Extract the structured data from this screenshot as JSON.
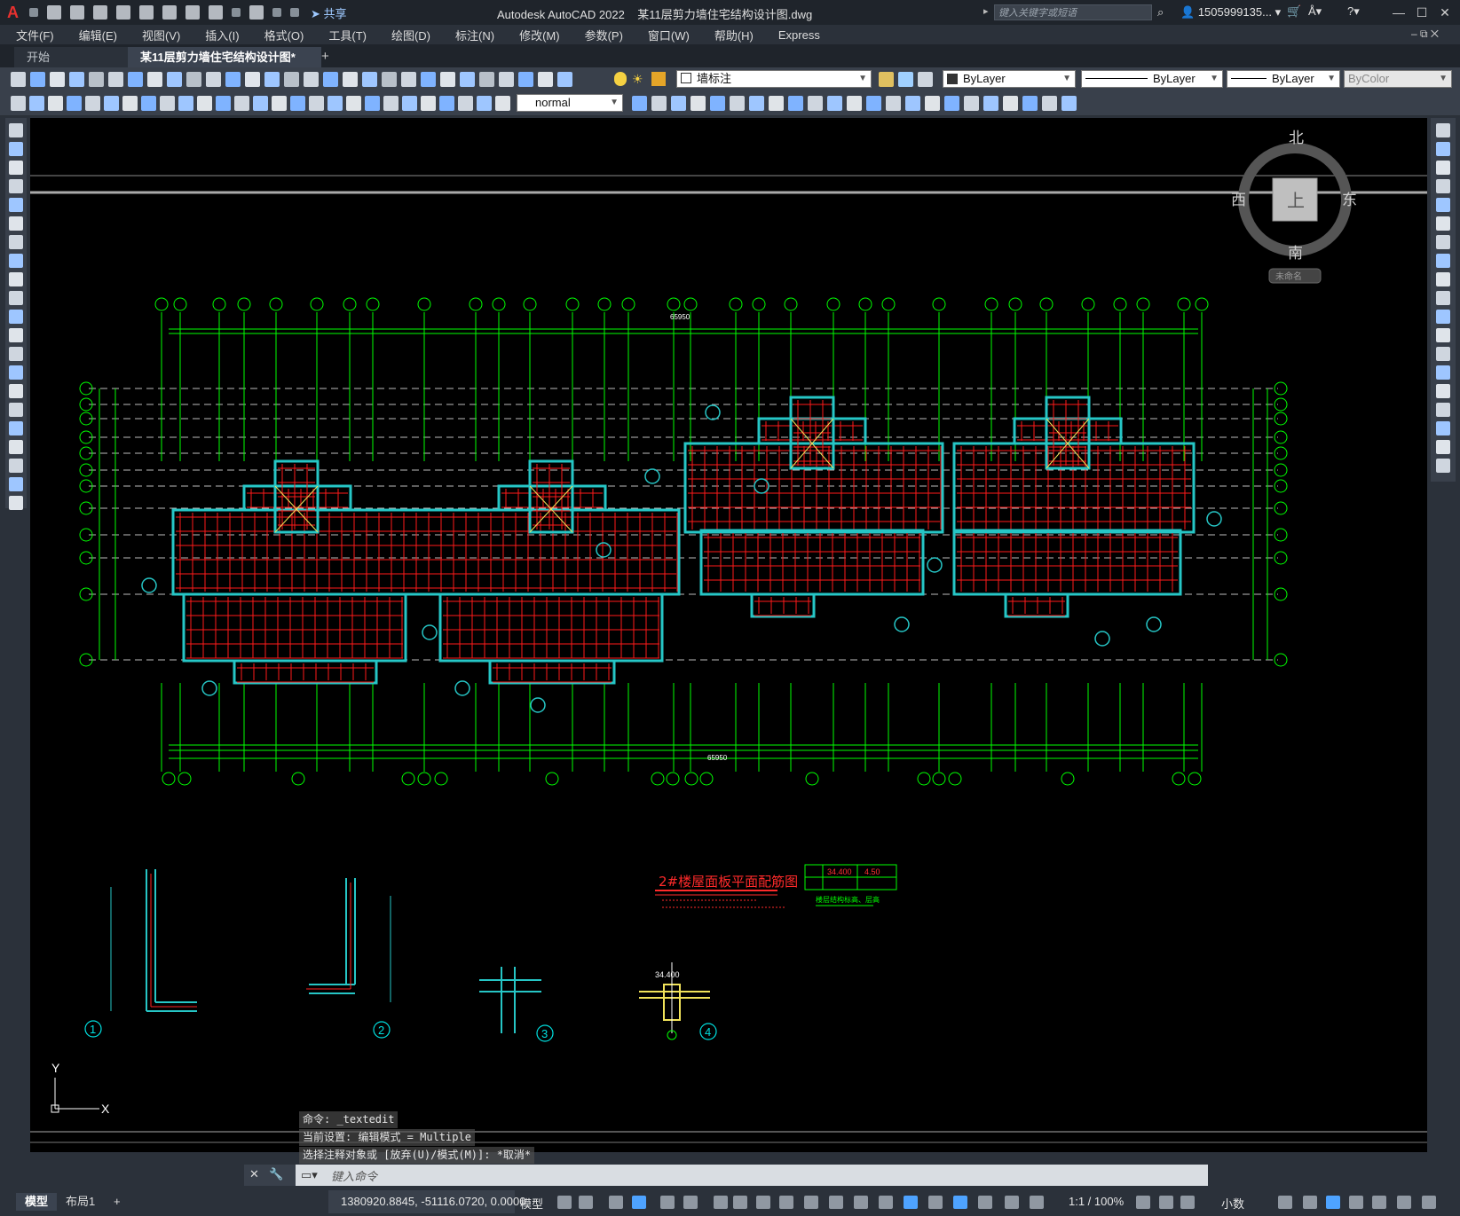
{
  "window": {
    "app_title": "Autodesk AutoCAD 2022",
    "file_title": "某11层剪力墙住宅结构设计图.dwg",
    "search_placeholder": "键入关键字或短语",
    "user": "1505999135...",
    "share_label": "共享",
    "app_logo": "A"
  },
  "menu": [
    "文件(F)",
    "编辑(E)",
    "视图(V)",
    "插入(I)",
    "格式(O)",
    "工具(T)",
    "绘图(D)",
    "标注(N)",
    "修改(M)",
    "参数(P)",
    "窗口(W)",
    "帮助(H)",
    "Express"
  ],
  "tabs": {
    "start": "开始",
    "drawing": "某11层剪力墙住宅结构设计图*",
    "new": "+"
  },
  "toolbar": {
    "layer": "墙标注",
    "color": "ByLayer",
    "linetype": "ByLayer",
    "lineweight": "ByLayer",
    "plotstyle": "ByColor",
    "textstyle": "normal"
  },
  "viewcube": {
    "north": "北",
    "south": "南",
    "east": "东",
    "west": "西",
    "top": "上",
    "wcs": "未命名"
  },
  "drawing": {
    "plan_title": "2#楼屋面板平面配筋图",
    "total_dim": "65950",
    "elev_label": "34.400",
    "table_elev": "34.400",
    "table_height": "4.50",
    "table_caption": "楼层结构标高、层高",
    "details": [
      "1",
      "2",
      "3",
      "4"
    ],
    "ucs_y": "Y",
    "ucs_x": "X"
  },
  "command": {
    "history": [
      "命令: _textedit",
      "当前设置: 编辑模式 = Multiple",
      "选择注释对象或 [放弃(U)/模式(M)]: *取消*"
    ],
    "placeholder": "键入命令"
  },
  "status": {
    "tab_model": "模型",
    "tab_layout": "布局1",
    "tab_add": "+",
    "coords": "1380920.8845, -51116.0720, 0.0000",
    "space": "模型",
    "scale": "1:1 / 100%",
    "units": "小数"
  }
}
